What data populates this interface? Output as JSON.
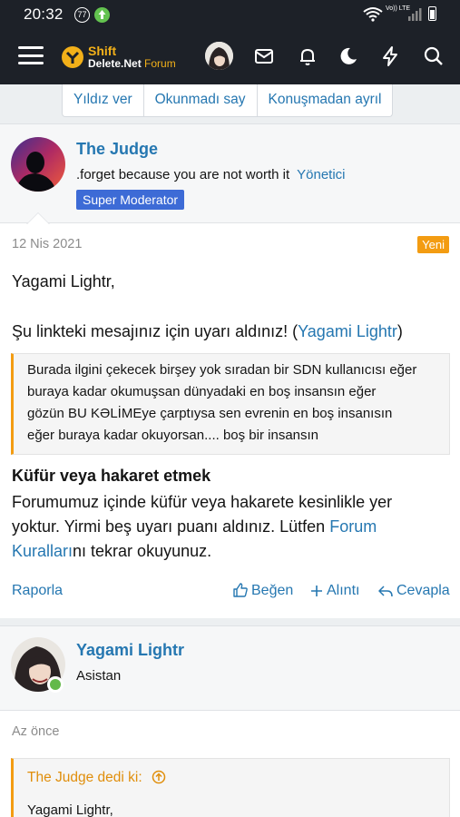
{
  "status_bar": {
    "time": "20:32",
    "notification_count": "77",
    "network_label": "Vo)) LTE"
  },
  "header": {
    "logo_line1": "Shift",
    "logo_line2": "Delete.Net",
    "logo_line2_suffix": "Forum"
  },
  "thread_actions": {
    "star": "Yıldız ver",
    "mark_unread": "Okunmadı say",
    "leave": "Konuşmadan ayrıl"
  },
  "post1": {
    "author": "The Judge",
    "custom_title": ".forget because you are not worth it",
    "role": "Yönetici",
    "badge": "Super Moderator",
    "date": "12 Nis 2021",
    "new_label": "Yeni",
    "greeting": "Yagami Lightr,",
    "line2_prefix": "Şu linkteki mesajınız için uyarı aldınız! (",
    "line2_link": "Yagami Lightr",
    "line2_suffix": ")",
    "quote_lines": [
      "Burada ilgini çekecek birşey yok sıradan bir SDN kullanıcısı eğer",
      "buraya kadar okumuşsan dünyadaki en boş insansın eğer",
      "gözün BU KƏLİMEye çarptıysa sen evrenin en boş insanısın",
      "eğer buraya kadar okuyorsan.... boş bir insansın"
    ],
    "reason_title": "Küfür veya hakaret etmek",
    "reason_line1": "Forumumuz içinde küfür veya hakarete kesinlikle yer",
    "reason_line2_prefix": "yoktur. Yirmi beş uyarı puanı aldınız. Lütfen ",
    "reason_link_part1": "Forum",
    "reason_link_part2": "Kuralları",
    "reason_line3_suffix": "nı tekrar okuyunuz.",
    "report": "Raporla",
    "like": "Beğen",
    "quote": "Alıntı",
    "reply": "Cevapla"
  },
  "post2": {
    "author": "Yagami Lightr",
    "custom_title": "Asistan",
    "date": "Az önce",
    "quote_head": "The Judge dedi ki:",
    "quote_body": "Yagami Lightr,"
  }
}
